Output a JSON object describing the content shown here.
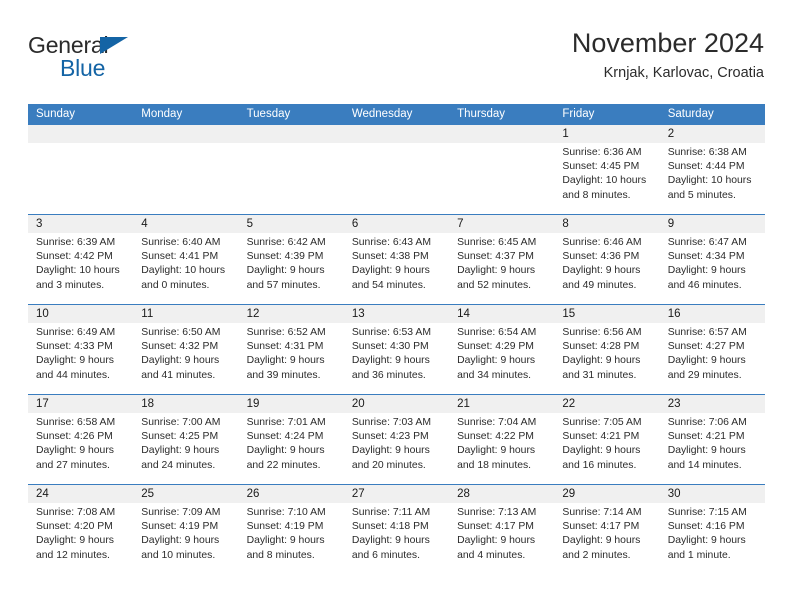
{
  "brand": {
    "line1": "General",
    "line2": "Blue",
    "triangle_color": "#1464a5"
  },
  "header": {
    "title": "November 2024",
    "location": "Krnjak, Karlovac, Croatia"
  },
  "theme": {
    "header_blue": "#3a7dbf",
    "date_band_gray": "#f0f0f0",
    "text": "#2b2b2b"
  },
  "labels": {
    "sunrise_prefix": "Sunrise:",
    "sunset_prefix": "Sunset:",
    "daylight_prefix": "Daylight:"
  },
  "weekdays": [
    "Sunday",
    "Monday",
    "Tuesday",
    "Wednesday",
    "Thursday",
    "Friday",
    "Saturday"
  ],
  "weeks": [
    [
      {
        "day": "",
        "empty": true
      },
      {
        "day": "",
        "empty": true
      },
      {
        "day": "",
        "empty": true
      },
      {
        "day": "",
        "empty": true
      },
      {
        "day": "",
        "empty": true
      },
      {
        "day": "1",
        "sunrise": "Sunrise: 6:36 AM",
        "sunset": "Sunset: 4:45 PM",
        "daylight1": "Daylight: 10 hours",
        "daylight2": "and 8 minutes."
      },
      {
        "day": "2",
        "sunrise": "Sunrise: 6:38 AM",
        "sunset": "Sunset: 4:44 PM",
        "daylight1": "Daylight: 10 hours",
        "daylight2": "and 5 minutes."
      }
    ],
    [
      {
        "day": "3",
        "sunrise": "Sunrise: 6:39 AM",
        "sunset": "Sunset: 4:42 PM",
        "daylight1": "Daylight: 10 hours",
        "daylight2": "and 3 minutes."
      },
      {
        "day": "4",
        "sunrise": "Sunrise: 6:40 AM",
        "sunset": "Sunset: 4:41 PM",
        "daylight1": "Daylight: 10 hours",
        "daylight2": "and 0 minutes."
      },
      {
        "day": "5",
        "sunrise": "Sunrise: 6:42 AM",
        "sunset": "Sunset: 4:39 PM",
        "daylight1": "Daylight: 9 hours",
        "daylight2": "and 57 minutes."
      },
      {
        "day": "6",
        "sunrise": "Sunrise: 6:43 AM",
        "sunset": "Sunset: 4:38 PM",
        "daylight1": "Daylight: 9 hours",
        "daylight2": "and 54 minutes."
      },
      {
        "day": "7",
        "sunrise": "Sunrise: 6:45 AM",
        "sunset": "Sunset: 4:37 PM",
        "daylight1": "Daylight: 9 hours",
        "daylight2": "and 52 minutes."
      },
      {
        "day": "8",
        "sunrise": "Sunrise: 6:46 AM",
        "sunset": "Sunset: 4:36 PM",
        "daylight1": "Daylight: 9 hours",
        "daylight2": "and 49 minutes."
      },
      {
        "day": "9",
        "sunrise": "Sunrise: 6:47 AM",
        "sunset": "Sunset: 4:34 PM",
        "daylight1": "Daylight: 9 hours",
        "daylight2": "and 46 minutes."
      }
    ],
    [
      {
        "day": "10",
        "sunrise": "Sunrise: 6:49 AM",
        "sunset": "Sunset: 4:33 PM",
        "daylight1": "Daylight: 9 hours",
        "daylight2": "and 44 minutes."
      },
      {
        "day": "11",
        "sunrise": "Sunrise: 6:50 AM",
        "sunset": "Sunset: 4:32 PM",
        "daylight1": "Daylight: 9 hours",
        "daylight2": "and 41 minutes."
      },
      {
        "day": "12",
        "sunrise": "Sunrise: 6:52 AM",
        "sunset": "Sunset: 4:31 PM",
        "daylight1": "Daylight: 9 hours",
        "daylight2": "and 39 minutes."
      },
      {
        "day": "13",
        "sunrise": "Sunrise: 6:53 AM",
        "sunset": "Sunset: 4:30 PM",
        "daylight1": "Daylight: 9 hours",
        "daylight2": "and 36 minutes."
      },
      {
        "day": "14",
        "sunrise": "Sunrise: 6:54 AM",
        "sunset": "Sunset: 4:29 PM",
        "daylight1": "Daylight: 9 hours",
        "daylight2": "and 34 minutes."
      },
      {
        "day": "15",
        "sunrise": "Sunrise: 6:56 AM",
        "sunset": "Sunset: 4:28 PM",
        "daylight1": "Daylight: 9 hours",
        "daylight2": "and 31 minutes."
      },
      {
        "day": "16",
        "sunrise": "Sunrise: 6:57 AM",
        "sunset": "Sunset: 4:27 PM",
        "daylight1": "Daylight: 9 hours",
        "daylight2": "and 29 minutes."
      }
    ],
    [
      {
        "day": "17",
        "sunrise": "Sunrise: 6:58 AM",
        "sunset": "Sunset: 4:26 PM",
        "daylight1": "Daylight: 9 hours",
        "daylight2": "and 27 minutes."
      },
      {
        "day": "18",
        "sunrise": "Sunrise: 7:00 AM",
        "sunset": "Sunset: 4:25 PM",
        "daylight1": "Daylight: 9 hours",
        "daylight2": "and 24 minutes."
      },
      {
        "day": "19",
        "sunrise": "Sunrise: 7:01 AM",
        "sunset": "Sunset: 4:24 PM",
        "daylight1": "Daylight: 9 hours",
        "daylight2": "and 22 minutes."
      },
      {
        "day": "20",
        "sunrise": "Sunrise: 7:03 AM",
        "sunset": "Sunset: 4:23 PM",
        "daylight1": "Daylight: 9 hours",
        "daylight2": "and 20 minutes."
      },
      {
        "day": "21",
        "sunrise": "Sunrise: 7:04 AM",
        "sunset": "Sunset: 4:22 PM",
        "daylight1": "Daylight: 9 hours",
        "daylight2": "and 18 minutes."
      },
      {
        "day": "22",
        "sunrise": "Sunrise: 7:05 AM",
        "sunset": "Sunset: 4:21 PM",
        "daylight1": "Daylight: 9 hours",
        "daylight2": "and 16 minutes."
      },
      {
        "day": "23",
        "sunrise": "Sunrise: 7:06 AM",
        "sunset": "Sunset: 4:21 PM",
        "daylight1": "Daylight: 9 hours",
        "daylight2": "and 14 minutes."
      }
    ],
    [
      {
        "day": "24",
        "sunrise": "Sunrise: 7:08 AM",
        "sunset": "Sunset: 4:20 PM",
        "daylight1": "Daylight: 9 hours",
        "daylight2": "and 12 minutes."
      },
      {
        "day": "25",
        "sunrise": "Sunrise: 7:09 AM",
        "sunset": "Sunset: 4:19 PM",
        "daylight1": "Daylight: 9 hours",
        "daylight2": "and 10 minutes."
      },
      {
        "day": "26",
        "sunrise": "Sunrise: 7:10 AM",
        "sunset": "Sunset: 4:19 PM",
        "daylight1": "Daylight: 9 hours",
        "daylight2": "and 8 minutes."
      },
      {
        "day": "27",
        "sunrise": "Sunrise: 7:11 AM",
        "sunset": "Sunset: 4:18 PM",
        "daylight1": "Daylight: 9 hours",
        "daylight2": "and 6 minutes."
      },
      {
        "day": "28",
        "sunrise": "Sunrise: 7:13 AM",
        "sunset": "Sunset: 4:17 PM",
        "daylight1": "Daylight: 9 hours",
        "daylight2": "and 4 minutes."
      },
      {
        "day": "29",
        "sunrise": "Sunrise: 7:14 AM",
        "sunset": "Sunset: 4:17 PM",
        "daylight1": "Daylight: 9 hours",
        "daylight2": "and 2 minutes."
      },
      {
        "day": "30",
        "sunrise": "Sunrise: 7:15 AM",
        "sunset": "Sunset: 4:16 PM",
        "daylight1": "Daylight: 9 hours",
        "daylight2": "and 1 minute."
      }
    ]
  ]
}
